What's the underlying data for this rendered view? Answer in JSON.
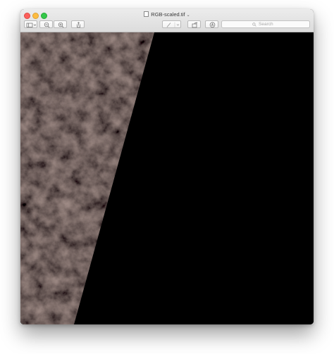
{
  "window": {
    "title": "RGB-scaled.tif"
  },
  "toolbar": {
    "sidebar_button": "sidebar-toggle",
    "zoom_out_button": "zoom-out",
    "zoom_in_button": "zoom-in",
    "share_button": "share",
    "markup_button": "markup-pen",
    "rotate_button": "rotate",
    "annotate_button": "annotate"
  },
  "search": {
    "placeholder": "Search"
  },
  "image": {
    "content": "satellite-image-tile",
    "colors": {
      "dark_texture": "#1c1b1d",
      "texture_highlight": "#3a2a26",
      "empty_region": "#000000"
    }
  }
}
